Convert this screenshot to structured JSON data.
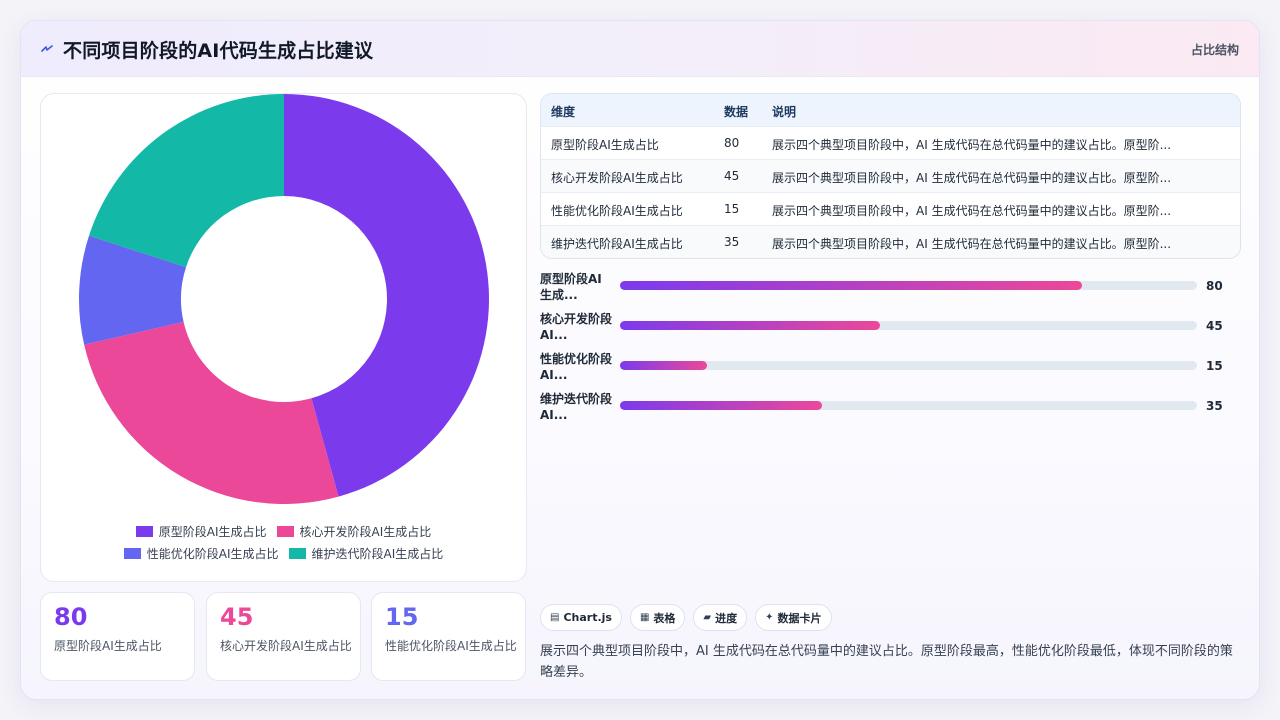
{
  "header": {
    "title": "不同项目阶段的AI代码生成占比建议",
    "tag": "占比结构",
    "icon": "flash-icon"
  },
  "colors": {
    "purple": "#7c3aed",
    "pink": "#ec4899",
    "indigo": "#6366f1",
    "teal": "#14b8a6"
  },
  "chart_data": {
    "type": "pie",
    "categories": [
      "原型阶段AI生成占比",
      "核心开发阶段AI生成占比",
      "性能优化阶段AI生成占比",
      "维护迭代阶段AI生成占比"
    ],
    "values": [
      80,
      45,
      15,
      35
    ],
    "colors": [
      "#7c3aed",
      "#ec4899",
      "#6366f1",
      "#14b8a6"
    ],
    "title": "",
    "legend": "bottom"
  },
  "legend": [
    {
      "label": "原型阶段AI生成占比",
      "color": "#7c3aed"
    },
    {
      "label": "核心开发阶段AI生成占比",
      "color": "#ec4899"
    },
    {
      "label": "性能优化阶段AI生成占比",
      "color": "#6366f1"
    },
    {
      "label": "维护迭代阶段AI生成占比",
      "color": "#14b8a6"
    }
  ],
  "stats": [
    {
      "value": "80",
      "label": "原型阶段AI生成占比",
      "color": "#7c3aed"
    },
    {
      "value": "45",
      "label": "核心开发阶段AI生成占比",
      "color": "#ec4899"
    },
    {
      "value": "15",
      "label": "性能优化阶段AI生成占比",
      "color": "#6366f1"
    }
  ],
  "table": {
    "headers": [
      "维度",
      "数据",
      "说明"
    ],
    "rows": [
      {
        "dim": "原型阶段AI生成占比",
        "val": "80",
        "note": "展示四个典型项目阶段中，AI 生成代码在总代码量中的建议占比。原型阶..."
      },
      {
        "dim": "核心开发阶段AI生成占比",
        "val": "45",
        "note": "展示四个典型项目阶段中，AI 生成代码在总代码量中的建议占比。原型阶..."
      },
      {
        "dim": "性能优化阶段AI生成占比",
        "val": "15",
        "note": "展示四个典型项目阶段中，AI 生成代码在总代码量中的建议占比。原型阶..."
      },
      {
        "dim": "维护迭代阶段AI生成占比",
        "val": "35",
        "note": "展示四个典型项目阶段中，AI 生成代码在总代码量中的建议占比。原型阶..."
      }
    ]
  },
  "bars": {
    "max": 100,
    "items": [
      {
        "label": "原型阶段AI生成...",
        "value": 80
      },
      {
        "label": "核心开发阶段AI...",
        "value": 45
      },
      {
        "label": "性能优化阶段AI...",
        "value": 15
      },
      {
        "label": "维护迭代阶段AI...",
        "value": 35
      }
    ]
  },
  "chips": [
    {
      "icon": "chart-icon",
      "glyph": "▤",
      "label": "Chart.js"
    },
    {
      "icon": "table-icon",
      "glyph": "▦",
      "label": "表格"
    },
    {
      "icon": "progress-icon",
      "glyph": "▰",
      "label": "进度"
    },
    {
      "icon": "sparkle-icon",
      "glyph": "✦",
      "label": "数据卡片"
    }
  ],
  "description": "展示四个典型项目阶段中，AI 生成代码在总代码量中的建议占比。原型阶段最高，性能优化阶段最低，体现不同阶段的策略差异。"
}
